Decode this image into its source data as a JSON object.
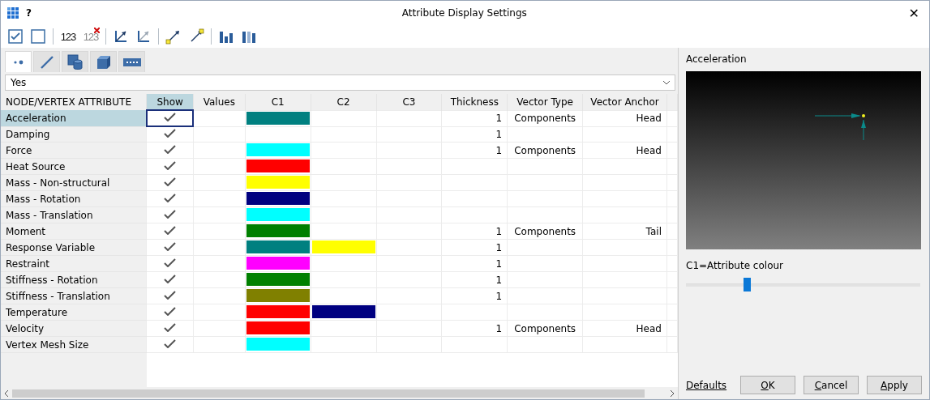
{
  "window": {
    "title": "Attribute Display Settings",
    "help": "?",
    "close": "✕"
  },
  "toolbar": [
    {
      "kind": "check-all"
    },
    {
      "kind": "uncheck-all"
    },
    {
      "kind": "sep"
    },
    {
      "kind": "numbers",
      "glyph": "123"
    },
    {
      "kind": "numbers-off",
      "glyph": "123"
    },
    {
      "kind": "sep"
    },
    {
      "kind": "axes"
    },
    {
      "kind": "axes-off"
    },
    {
      "kind": "sep"
    },
    {
      "kind": "vector-tail"
    },
    {
      "kind": "vector-head"
    },
    {
      "kind": "sep"
    },
    {
      "kind": "bars"
    },
    {
      "kind": "bars-light"
    }
  ],
  "tabs": [
    {
      "kind": "node",
      "selected": true
    },
    {
      "kind": "line",
      "selected": false
    },
    {
      "kind": "surface",
      "selected": false
    },
    {
      "kind": "solid",
      "selected": false
    },
    {
      "kind": "link",
      "selected": false
    }
  ],
  "filter": {
    "value": "Yes"
  },
  "table": {
    "columns": [
      "NODE/VERTEX ATTRIBUTE",
      "Show",
      "Values",
      "C1",
      "C2",
      "C3",
      "Thickness",
      "Vector Type",
      "Vector Anchor"
    ],
    "rows": [
      {
        "name": "Acceleration",
        "selected": true,
        "show": true,
        "c1": {
          "color": "#008080"
        },
        "thickness": "1",
        "vector_type": "Components",
        "vector_anchor": "Head"
      },
      {
        "name": "Damping",
        "selected": false,
        "show": true,
        "thickness": "1"
      },
      {
        "name": "Force",
        "selected": false,
        "show": true,
        "c1": {
          "color": "#00ffff"
        },
        "thickness": "1",
        "vector_type": "Components",
        "vector_anchor": "Head"
      },
      {
        "name": "Heat Source",
        "selected": false,
        "show": true,
        "c1": {
          "color": "#ff0000"
        }
      },
      {
        "name": "Mass - Non-structural",
        "selected": false,
        "show": true,
        "c1": {
          "color": "#ffff00"
        }
      },
      {
        "name": "Mass - Rotation",
        "selected": false,
        "show": true,
        "c1": {
          "color": "#000080"
        }
      },
      {
        "name": "Mass - Translation",
        "selected": false,
        "show": true,
        "c1": {
          "color": "#00ffff"
        }
      },
      {
        "name": "Moment",
        "selected": false,
        "show": true,
        "c1": {
          "color": "#008000"
        },
        "thickness": "1",
        "vector_type": "Components",
        "vector_anchor": "Tail"
      },
      {
        "name": "Response Variable",
        "selected": false,
        "show": true,
        "c1": {
          "color": "#008080"
        },
        "c2": {
          "color": "#ffff00"
        },
        "thickness": "1"
      },
      {
        "name": "Restraint",
        "selected": false,
        "show": true,
        "c1": {
          "color": "#ff00ff"
        },
        "thickness": "1"
      },
      {
        "name": "Stiffness - Rotation",
        "selected": false,
        "show": true,
        "c1": {
          "color": "#008000"
        },
        "thickness": "1"
      },
      {
        "name": "Stiffness - Translation",
        "selected": false,
        "show": true,
        "c1": {
          "color": "#808000"
        },
        "thickness": "1"
      },
      {
        "name": "Temperature",
        "selected": false,
        "show": true,
        "c1": {
          "color": "#ff0000"
        },
        "c2": {
          "color": "#000080"
        }
      },
      {
        "name": "Velocity",
        "selected": false,
        "show": true,
        "c1": {
          "color": "#ff0000"
        },
        "thickness": "1",
        "vector_type": "Components",
        "vector_anchor": "Head"
      },
      {
        "name": "Vertex Mesh Size",
        "selected": false,
        "show": true,
        "c1": {
          "color": "#00ffff"
        }
      }
    ]
  },
  "preview": {
    "title": "Acceleration",
    "caption": "C1=Attribute colour",
    "slider": {
      "level": 0.26
    }
  },
  "footer": {
    "link": "Defaults",
    "buttons": [
      "OK",
      "Cancel",
      "Apply"
    ]
  }
}
